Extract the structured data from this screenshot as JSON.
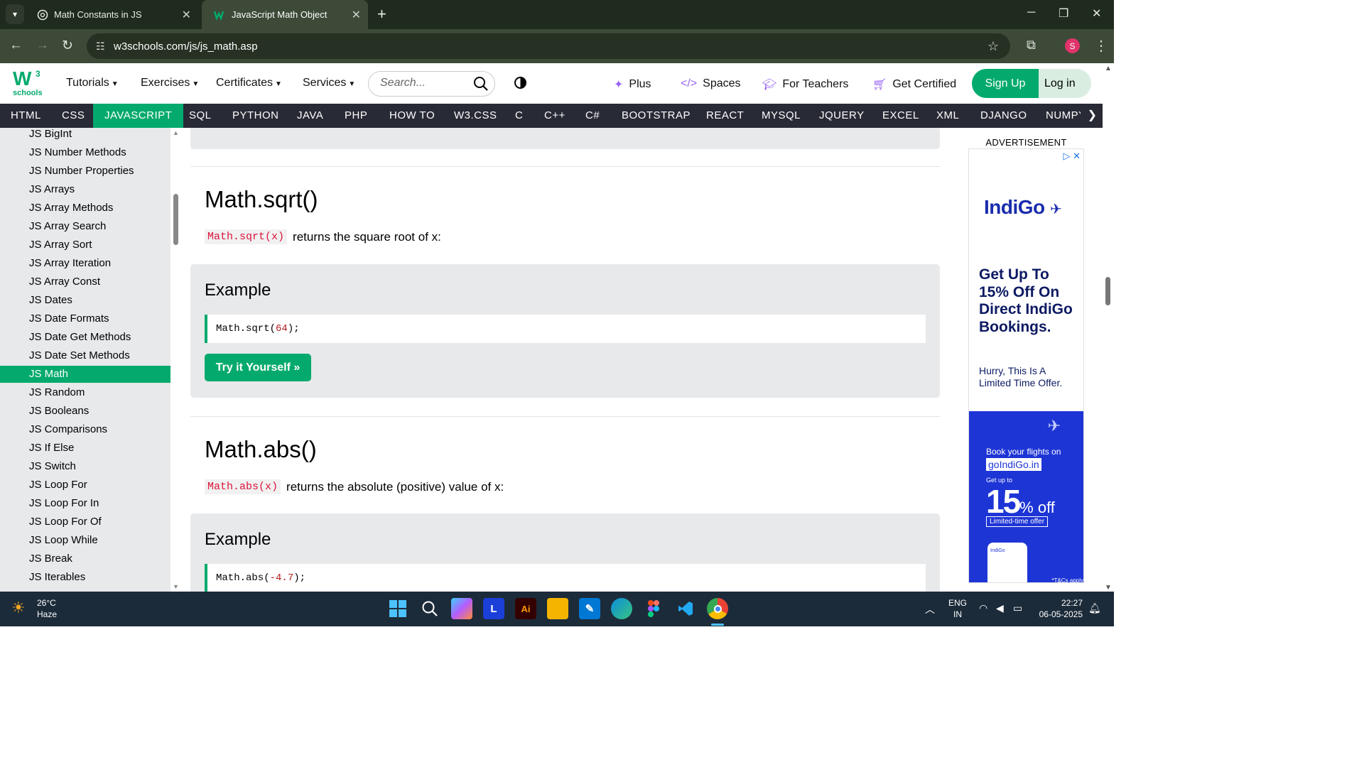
{
  "browser": {
    "tabs": [
      {
        "title": "Math Constants in JS",
        "active": false,
        "favicon": "chatgpt-icon"
      },
      {
        "title": "JavaScript Math Object",
        "active": true,
        "favicon": "w3schools-icon"
      }
    ],
    "url": "w3schools.com/js/js_math.asp",
    "profile_initial": "S"
  },
  "header": {
    "logo_text": "W",
    "logo_sup": "3",
    "logo_sub": "schools",
    "menus": [
      "Tutorials",
      "Exercises",
      "Certificates",
      "Services"
    ],
    "search_placeholder": "Search...",
    "links": [
      "Plus",
      "Spaces",
      "For Teachers",
      "Get Certified"
    ],
    "signup": "Sign Up",
    "login": "Log in"
  },
  "topnav": {
    "items": [
      "HTML",
      "CSS",
      "JAVASCRIPT",
      "SQL",
      "PYTHON",
      "JAVA",
      "PHP",
      "HOW TO",
      "W3.CSS",
      "C",
      "C++",
      "C#",
      "BOOTSTRAP",
      "REACT",
      "MYSQL",
      "JQUERY",
      "EXCEL",
      "XML",
      "DJANGO",
      "NUMPY"
    ],
    "active": "JAVASCRIPT"
  },
  "sidebar": {
    "items": [
      "JS BigInt",
      "JS Number Methods",
      "JS Number Properties",
      "JS Arrays",
      "JS Array Methods",
      "JS Array Search",
      "JS Array Sort",
      "JS Array Iteration",
      "JS Array Const",
      "JS Dates",
      "JS Date Formats",
      "JS Date Get Methods",
      "JS Date Set Methods",
      "JS Math",
      "JS Random",
      "JS Booleans",
      "JS Comparisons",
      "JS If Else",
      "JS Switch",
      "JS Loop For",
      "JS Loop For In",
      "JS Loop For Of",
      "JS Loop While",
      "JS Break",
      "JS Iterables"
    ],
    "active": "JS Math"
  },
  "main": {
    "sections": [
      {
        "title": "Math.sqrt()",
        "code_inline": "Math.sqrt(x)",
        "description": "returns the square root of x:",
        "example_label": "Example",
        "code_fn": "Math.sqrt(",
        "code_arg": "64",
        "code_end": ");",
        "try_label": "Try it Yourself »"
      },
      {
        "title": "Math.abs()",
        "code_inline": "Math.abs(x)",
        "description": "returns the absolute (positive) value of x:",
        "example_label": "Example",
        "code_fn": "Math.abs(",
        "code_arg": "-4.7",
        "code_end": ");"
      }
    ]
  },
  "ad": {
    "label": "ADVERTISEMENT",
    "brand": "IndiGo",
    "headline": "Get Up To 15% Off On Direct IndiGo Bookings.",
    "subtext": "Hurry, This Is A Limited Time Offer.",
    "book_text": "Book your flights on",
    "site": "goIndiGo.in",
    "get_up_to": "Get up to",
    "percent": "15",
    "off": "% off",
    "limited": "Limited-time offer",
    "phone_brand": "IndiGo",
    "tc": "*T&Cs apply"
  },
  "taskbar": {
    "temperature": "26°C",
    "weather": "Haze",
    "lang": "ENG",
    "region": "IN",
    "time": "22:27",
    "date": "06-05-2025"
  },
  "colors": {
    "accent": "#04aa6d",
    "topnav": "#282a35",
    "sidebar": "#e7e9eb",
    "chrome": "#1f2b1d"
  }
}
